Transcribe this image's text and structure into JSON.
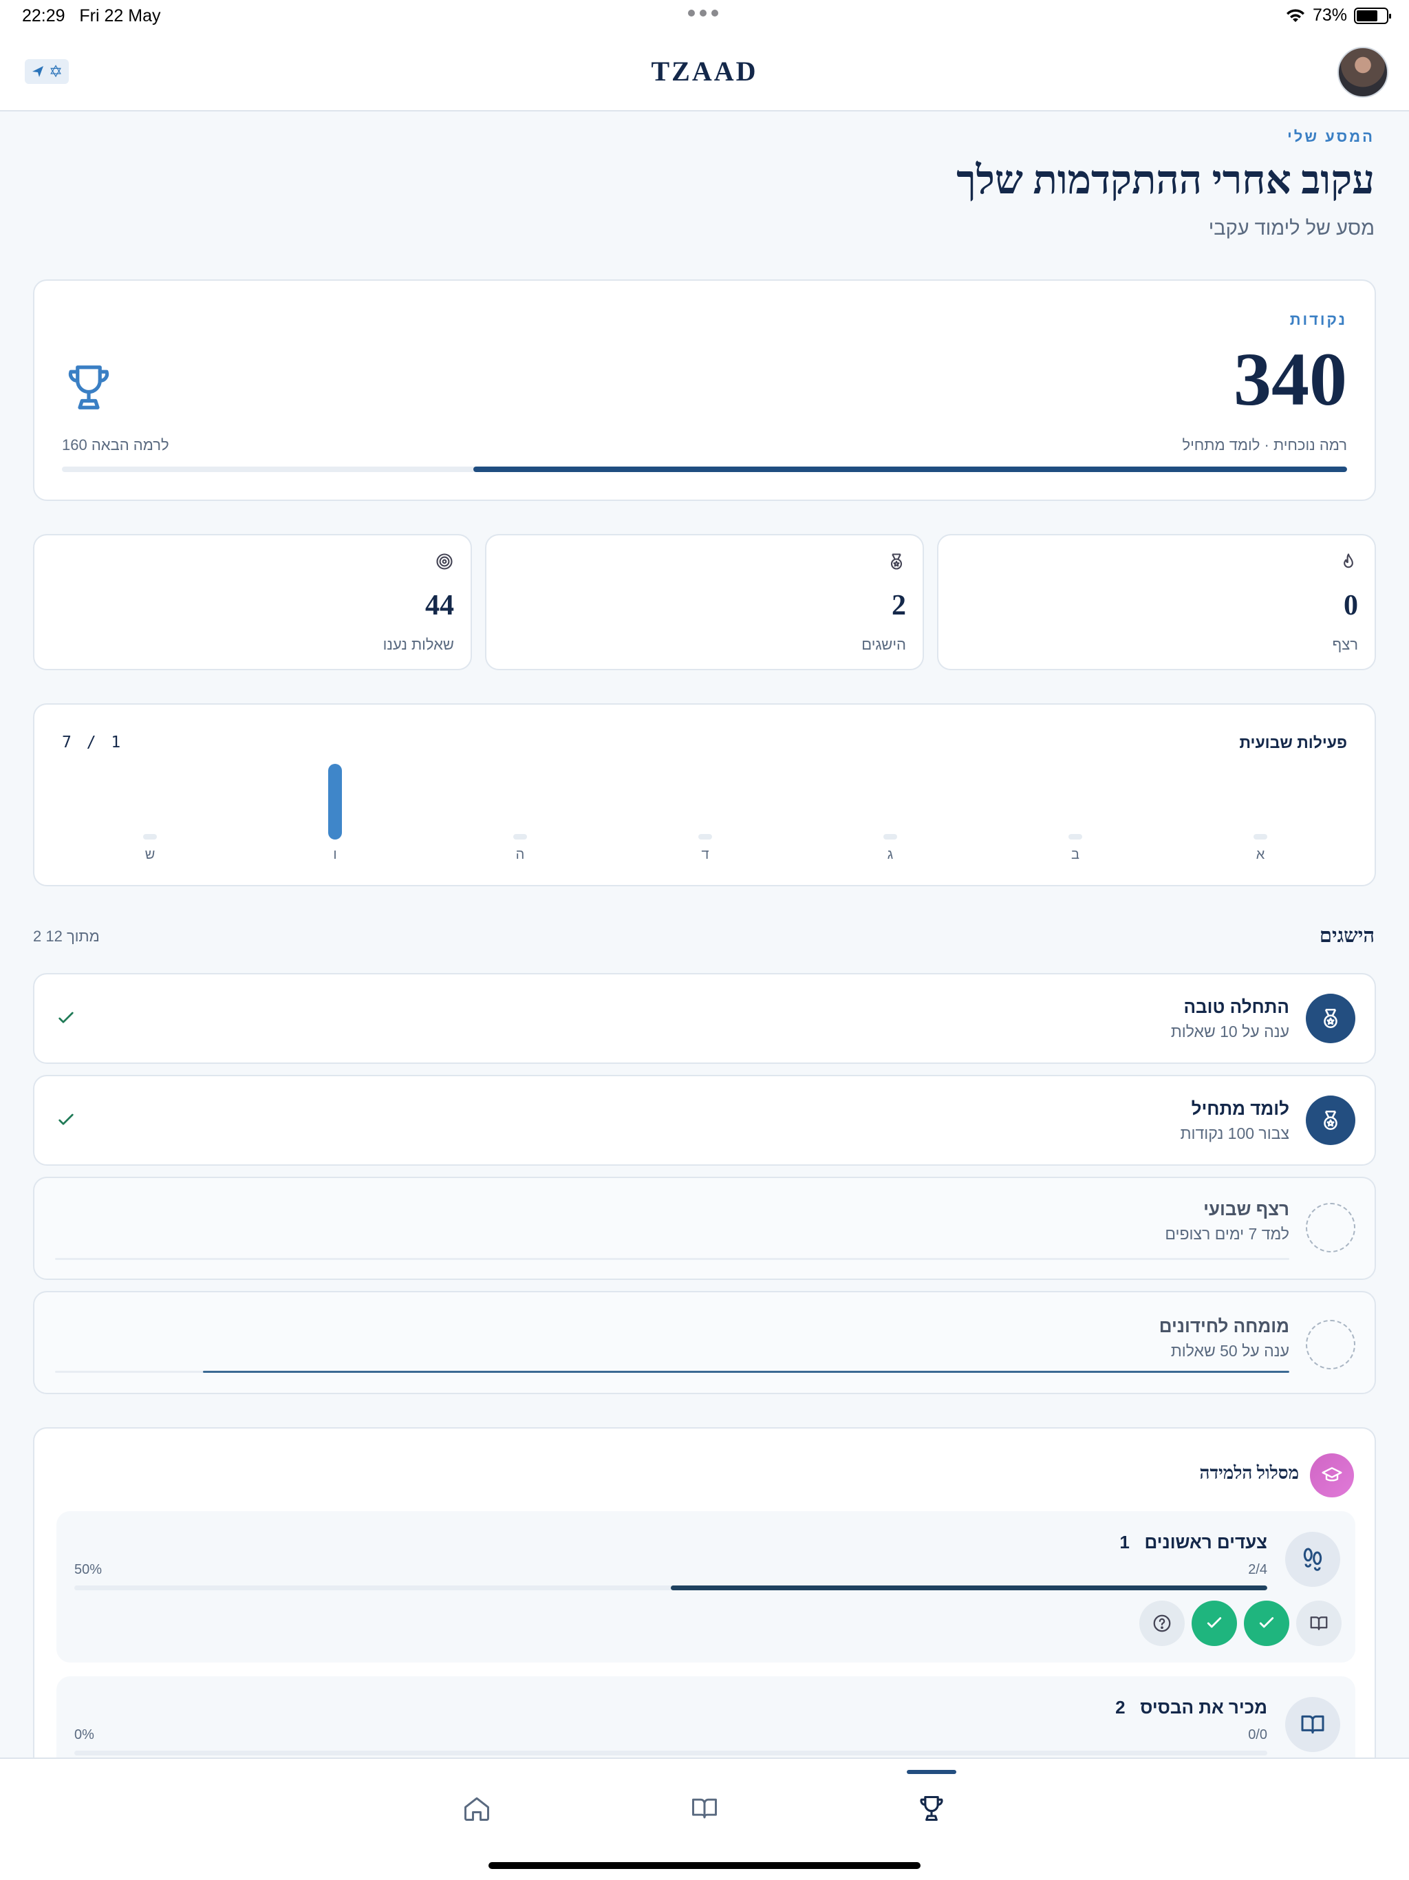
{
  "status_bar": {
    "time": "22:29",
    "date": "Fri 22 May",
    "battery": "73%",
    "battery_level": 0.73
  },
  "nav": {
    "title": "TZAAD",
    "flag_icon": "israel-flag-icon",
    "avatar": "user-avatar"
  },
  "header": {
    "eyebrow": "המסע שלי",
    "title": "עקוב אחרי ההתקדמות שלך",
    "subtitle": "מסע של לימוד עקבי"
  },
  "points": {
    "label": "נקודות",
    "value": "340",
    "level_text": "רמה נוכחית · לומד מתחיל",
    "next_text": "160 לרמה הבאה",
    "progress": 0.68
  },
  "stats": [
    {
      "icon": "flame-icon",
      "value": "0",
      "label": "רצף"
    },
    {
      "icon": "medal-icon",
      "value": "2",
      "label": "הישגים"
    },
    {
      "icon": "target-icon",
      "value": "44",
      "label": "שאלות נענו"
    }
  ],
  "weekly": {
    "title": "פעילות שבועית",
    "count": "7 / 1",
    "days": [
      {
        "label": "א",
        "value": 0
      },
      {
        "label": "ב",
        "value": 0
      },
      {
        "label": "ג",
        "value": 0
      },
      {
        "label": "ד",
        "value": 0
      },
      {
        "label": "ה",
        "value": 0
      },
      {
        "label": "ו",
        "value": 1
      },
      {
        "label": "ש",
        "value": 0
      }
    ]
  },
  "achievements": {
    "title": "הישגים",
    "count": "2 מתוך 12",
    "items": [
      {
        "title": "התחלה טובה",
        "desc": "ענה על 10 שאלות",
        "unlocked": true,
        "progress": 1
      },
      {
        "title": "לומד מתחיל",
        "desc": "צבור 100 נקודות",
        "unlocked": true,
        "progress": 1
      },
      {
        "title": "רצף שבועי",
        "desc": "למד 7 ימים רצופים",
        "unlocked": false,
        "progress": 0
      },
      {
        "title": "מומחה לחידונים",
        "desc": "ענה על 50 שאלות",
        "unlocked": false,
        "progress": 0.88
      }
    ]
  },
  "path": {
    "title": "מסלול הלמידה",
    "steps": [
      {
        "num": "1",
        "name": "צעדים ראשונים",
        "fraction": "2/4",
        "percent": "50%",
        "progress": 0.5,
        "icon": "footprints-icon"
      },
      {
        "num": "2",
        "name": "מכיר את הבסיס",
        "fraction": "0/0",
        "percent": "0%",
        "progress": 0,
        "icon": "book-open-icon"
      }
    ]
  },
  "tabs": [
    "home-tab",
    "learn-tab",
    "achievements-tab"
  ]
}
